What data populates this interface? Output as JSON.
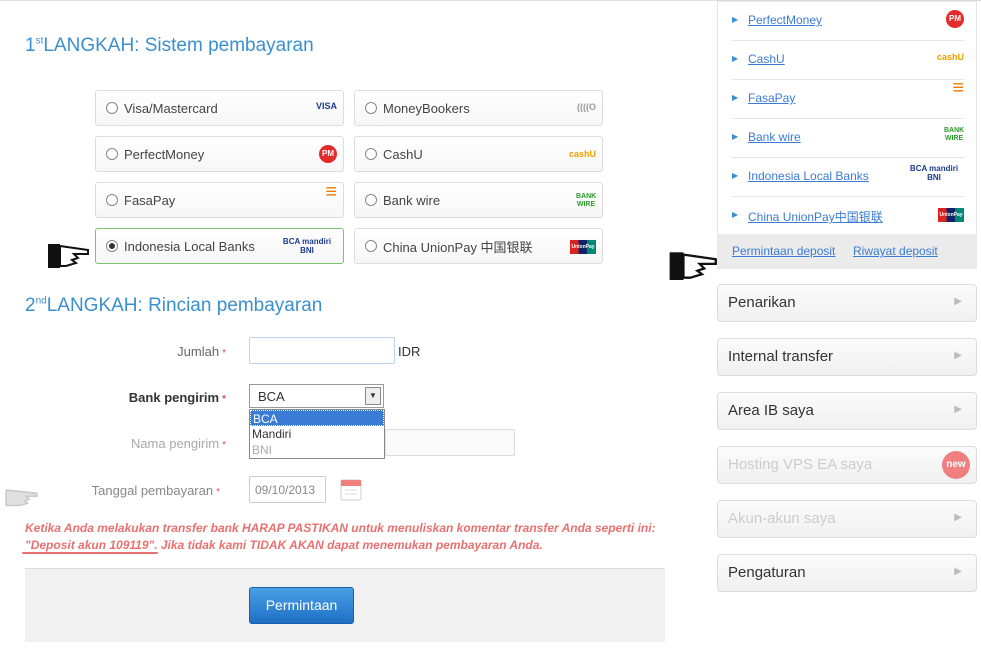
{
  "step1": {
    "num": "1",
    "sup": "st",
    "title": "LANGKAH: Sistem pembayaran"
  },
  "payment_options": [
    {
      "label": "Visa/Mastercard",
      "logo": "VISA",
      "selected": false
    },
    {
      "label": "MoneyBookers",
      "logo": "((((O",
      "selected": false
    },
    {
      "label": "PerfectMoney",
      "logo": "PM",
      "selected": false
    },
    {
      "label": "CashU",
      "logo": "cashU",
      "selected": false
    },
    {
      "label": "FasaPay",
      "logo": "≡",
      "selected": false
    },
    {
      "label": "Bank wire",
      "logo": "BANK WIRE",
      "selected": false
    },
    {
      "label": "Indonesia Local Banks",
      "logo": "BCA mandiri BNI",
      "selected": true
    },
    {
      "label": "China UnionPay 中国银联",
      "logo": "UnionPay",
      "selected": false
    }
  ],
  "step2": {
    "num": "2",
    "sup": "nd",
    "title": "LANGKAH: Rincian pembayaran"
  },
  "form": {
    "amount_label": "Jumlah",
    "amount_currency": "IDR",
    "bank_label": "Bank pengirim",
    "bank_value": "BCA",
    "bank_options": [
      "BCA",
      "Mandiri",
      "BNI"
    ],
    "sender_label": "Nama pengirim",
    "date_label": "Tanggal pembayaran",
    "date_value": "09/10/2013",
    "required_mark": "*"
  },
  "warning": {
    "line1": "Ketika Anda melakukan transfer bank HARAP PASTIKAN untuk menuliskan komentar transfer Anda seperti ini:",
    "line2": "\"Deposit akun 109119\". Jika tidak kami TIDAK AKAN dapat menemukan pembayaran Anda."
  },
  "submit_label": "Permintaan",
  "sidebar": {
    "methods": [
      {
        "label": "PerfectMoney",
        "logo": "PM"
      },
      {
        "label": "CashU",
        "logo": "cashU"
      },
      {
        "label": "FasaPay",
        "logo": "≡"
      },
      {
        "label": "Bank wire",
        "logo": "BANK WIRE"
      },
      {
        "label": "Indonesia Local Banks",
        "logo": "BCA mandiri BNI"
      },
      {
        "label": "China UnionPay中国银联",
        "logo": "UnionPay"
      }
    ],
    "link_deposit": "Permintaan deposit",
    "link_history": "Riwayat deposit",
    "menu": [
      {
        "label": "Penarikan",
        "faded": false
      },
      {
        "label": "Internal transfer",
        "faded": false
      },
      {
        "label": "Area IB saya",
        "faded": false
      },
      {
        "label": "Hosting VPS EA saya",
        "faded": true,
        "badge": "new"
      },
      {
        "label": "Akun-akun saya",
        "faded": true
      },
      {
        "label": "Pengaturan",
        "faded": false
      }
    ]
  },
  "colors": {
    "accent": "#3a8fd0",
    "warning": "#e87070",
    "button": "#1f6fc5"
  }
}
